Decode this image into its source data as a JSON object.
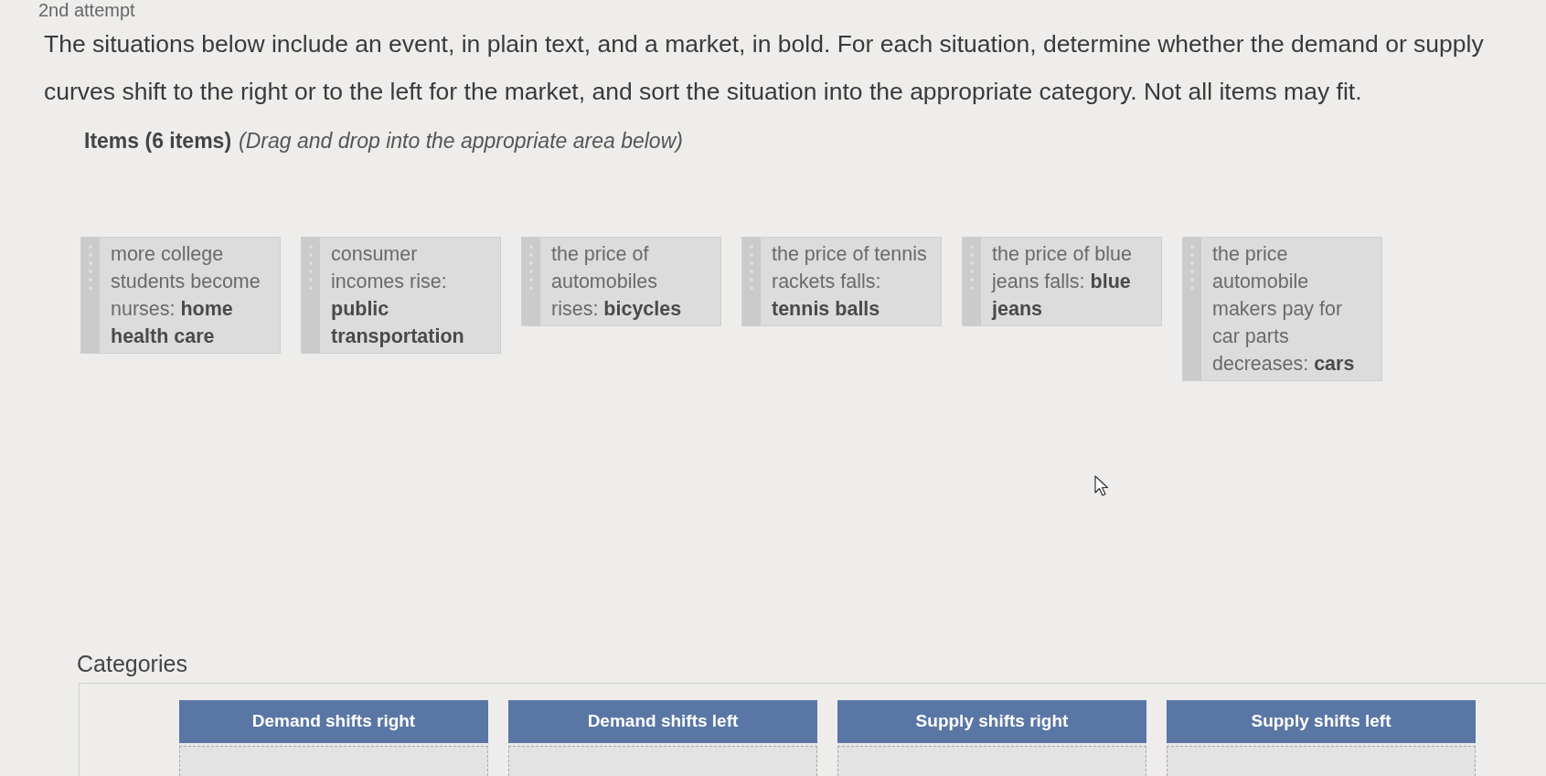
{
  "heading": "2nd attempt",
  "instructions": "The situations below include an event, in plain text, and a market, in bold. For each situation, determine whether the demand or supply curves shift to the right or to the left for the market, and sort the situation into the appropriate category. Not all items may fit.",
  "items_header": {
    "title": "Items (6 items)",
    "hint": "(Drag and drop into the appropriate area below)"
  },
  "items": [
    {
      "text": "more college students become nurses: **home health care**"
    },
    {
      "text": "consumer incomes rise: **public transportation**"
    },
    {
      "text": "the price of automobiles rises: **bicycles**"
    },
    {
      "text": "the price of tennis rackets falls: **tennis balls**"
    },
    {
      "text": "the price of blue jeans falls: **blue jeans**"
    },
    {
      "text": "the price automobile makers pay for car parts decreases: **cars**"
    }
  ],
  "categories_title": "Categories",
  "categories": [
    {
      "label": "Demand shifts right"
    },
    {
      "label": "Demand shifts left"
    },
    {
      "label": "Supply shifts right"
    },
    {
      "label": "Supply shifts left"
    }
  ]
}
